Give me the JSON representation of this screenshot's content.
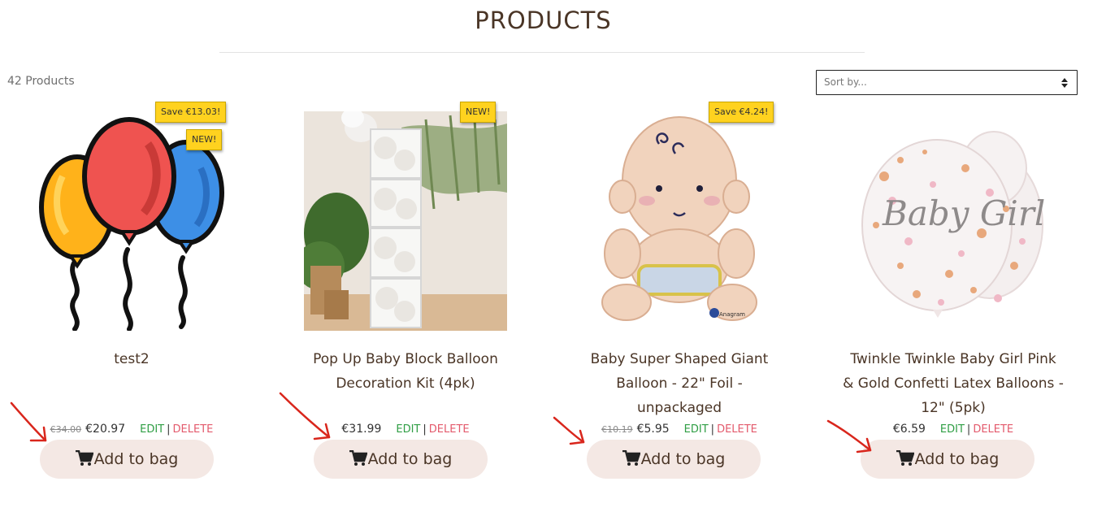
{
  "header": {
    "title": "PRODUCTS"
  },
  "toolbar": {
    "count_text": "42 Products",
    "sort_placeholder": "Sort by..."
  },
  "products": [
    {
      "name": "test2",
      "old_price": "€34.00",
      "price": "€20.97",
      "badges": [
        "Save €13.03!",
        "NEW!"
      ],
      "edit": "EDIT",
      "sep": "|",
      "delete": "DELETE",
      "cta": "Add to bag"
    },
    {
      "name": "Pop Up Baby Block Balloon Decoration Kit (4pk)",
      "old_price": "",
      "price": "€31.99",
      "badges": [
        "NEW!"
      ],
      "edit": "EDIT",
      "sep": "|",
      "delete": "DELETE",
      "cta": "Add to bag"
    },
    {
      "name": "Baby Super Shaped Giant Balloon - 22\" Foil - unpackaged",
      "old_price": "€10.19",
      "price": "€5.95",
      "badges": [
        "Save €4.24!"
      ],
      "edit": "EDIT",
      "sep": "|",
      "delete": "DELETE",
      "cta": "Add to bag"
    },
    {
      "name": "Twinkle Twinkle Baby Girl Pink & Gold Confetti Latex Balloons - 12\" (5pk)",
      "old_price": "",
      "price": "€6.59",
      "badges": [],
      "edit": "EDIT",
      "sep": "|",
      "delete": "DELETE",
      "cta": "Add to bag"
    }
  ],
  "image_text": {
    "brand_mark": "Anagram",
    "balloon_script": "Baby Girl"
  },
  "colors": {
    "text": "#4a3526",
    "badge": "#ffd21f",
    "button_bg": "#f4e8e4",
    "edit": "#2f9e44",
    "delete": "#e35a6c",
    "annotation_arrow": "#d9261c"
  },
  "icons": {
    "cart": "cart-icon",
    "sort": "sort-arrows-icon",
    "annotation": "red-arrow-annotation"
  }
}
